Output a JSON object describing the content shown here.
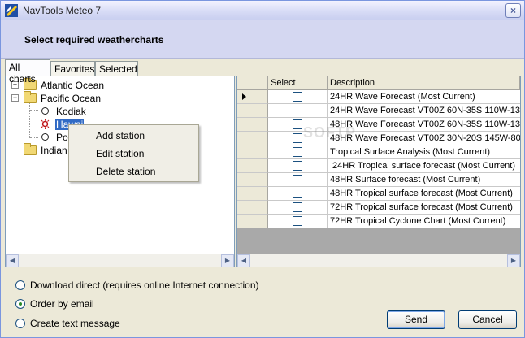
{
  "window": {
    "title": "NavTools Meteo 7",
    "close_glyph": "×",
    "app_icon": "navtools-logo-icon"
  },
  "header": {
    "heading": "Select required weathercharts"
  },
  "tabs": [
    {
      "label": "All charts",
      "active": true
    },
    {
      "label": "Favorites",
      "active": false
    },
    {
      "label": "Selected",
      "active": false
    }
  ],
  "tree": {
    "nodes": [
      {
        "label": "Atlantic Ocean",
        "type": "folder",
        "expander": "+"
      },
      {
        "label": "Pacific Ocean",
        "type": "folder",
        "expander": "−"
      },
      {
        "label": "Kodiak",
        "type": "station"
      },
      {
        "label": "Hawai",
        "type": "station-selected"
      },
      {
        "label": "Po",
        "type": "station"
      },
      {
        "label": "Indian",
        "type": "folder",
        "expander": "+"
      }
    ]
  },
  "context_menu": {
    "items": [
      "Add station",
      "Edit station",
      "Delete station"
    ]
  },
  "grid": {
    "columns": {
      "select": "Select",
      "description": "Description"
    },
    "rows": [
      {
        "description": "24HR Wave Forecast (Most Current)",
        "current": true
      },
      {
        "description": "24HR Wave Forecast VT00Z 60N-35S 110W-13"
      },
      {
        "description": "48HR Wave Forecast VT00Z 60N-35S 110W-13"
      },
      {
        "description": "48HR Wave Forecast VT00Z 30N-20S 145W-80"
      },
      {
        "description": "Tropical Surface Analysis (Most Current)"
      },
      {
        "description": " 24HR Tropical surface forecast (Most Current)"
      },
      {
        "description": "48HR Surface forecast (Most Current)"
      },
      {
        "description": "48HR Tropical surface forecast (Most Current)"
      },
      {
        "description": "72HR Tropical surface forecast (Most Current)"
      },
      {
        "description": "72HR Tropical Cyclone Chart (Most Current)"
      }
    ]
  },
  "watermark": "SOFTP",
  "options": [
    {
      "label": "Download direct (requires online Internet connection)",
      "checked": false
    },
    {
      "label": "Order by email",
      "checked": true
    },
    {
      "label": "Create text message",
      "checked": false
    }
  ],
  "buttons": {
    "send": "Send",
    "cancel": "Cancel"
  },
  "colors": {
    "selection": "#316ac5",
    "header_panel": "#d4d7f1",
    "window_bg": "#ece9d8"
  }
}
